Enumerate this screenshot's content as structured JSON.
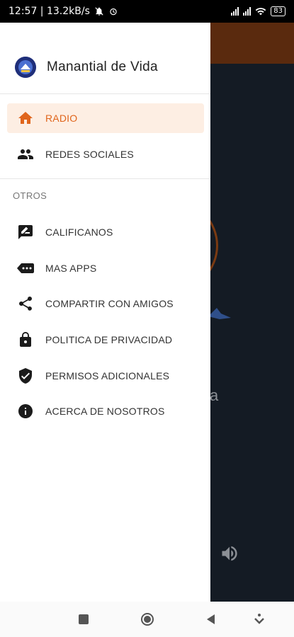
{
  "status_bar": {
    "time_speed": "12:57 | 13.2kB/s",
    "battery": "83"
  },
  "app": {
    "title": "Manantial de Vida",
    "background_partial_text": "a"
  },
  "drawer": {
    "primary_items": [
      {
        "label": "RADIO",
        "icon": "home-icon",
        "active": true
      },
      {
        "label": "REDES SOCIALES",
        "icon": "people-icon",
        "active": false
      }
    ],
    "section_label": "OTROS",
    "other_items": [
      {
        "label": "CALIFICANOS",
        "icon": "rate-review-icon"
      },
      {
        "label": "MAS APPS",
        "icon": "more-apps-icon"
      },
      {
        "label": "COMPARTIR CON AMIGOS",
        "icon": "share-icon"
      },
      {
        "label": "POLITICA DE PRIVACIDAD",
        "icon": "lock-icon"
      },
      {
        "label": "PERMISOS ADICIONALES",
        "icon": "shield-check-icon"
      },
      {
        "label": "ACERCA DE NOSOTROS",
        "icon": "info-icon"
      }
    ]
  },
  "colors": {
    "accent": "#e0651c",
    "active_bg": "#fdeee3",
    "scrim": "#141b24"
  }
}
